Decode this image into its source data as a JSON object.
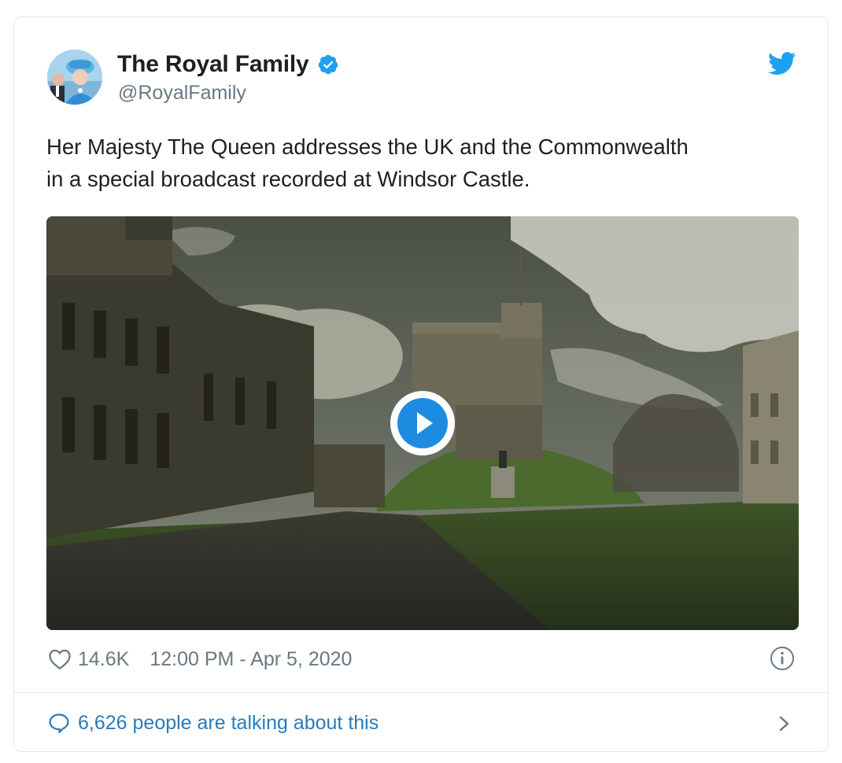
{
  "tweet": {
    "display_name": "The Royal Family",
    "handle": "@RoyalFamily",
    "verified": true,
    "text": "Her Majesty The Queen addresses the UK and the Commonwealth\nin a special broadcast recorded at Windsor Castle.",
    "like_count": "14.6K",
    "timestamp": "12:00 PM - Apr 5, 2020",
    "conversation": "6,626 people are talking about this"
  },
  "colors": {
    "accent": "#1da1f2",
    "link": "#2b7bb9",
    "muted": "#697882",
    "border": "#e1e8ed"
  },
  "icons": {
    "verified": "verified-badge-icon",
    "platform": "twitter-bird-icon",
    "play": "play-icon",
    "like": "heart-icon",
    "info": "info-icon",
    "reply": "speech-bubble-icon",
    "more": "chevron-right-icon"
  }
}
